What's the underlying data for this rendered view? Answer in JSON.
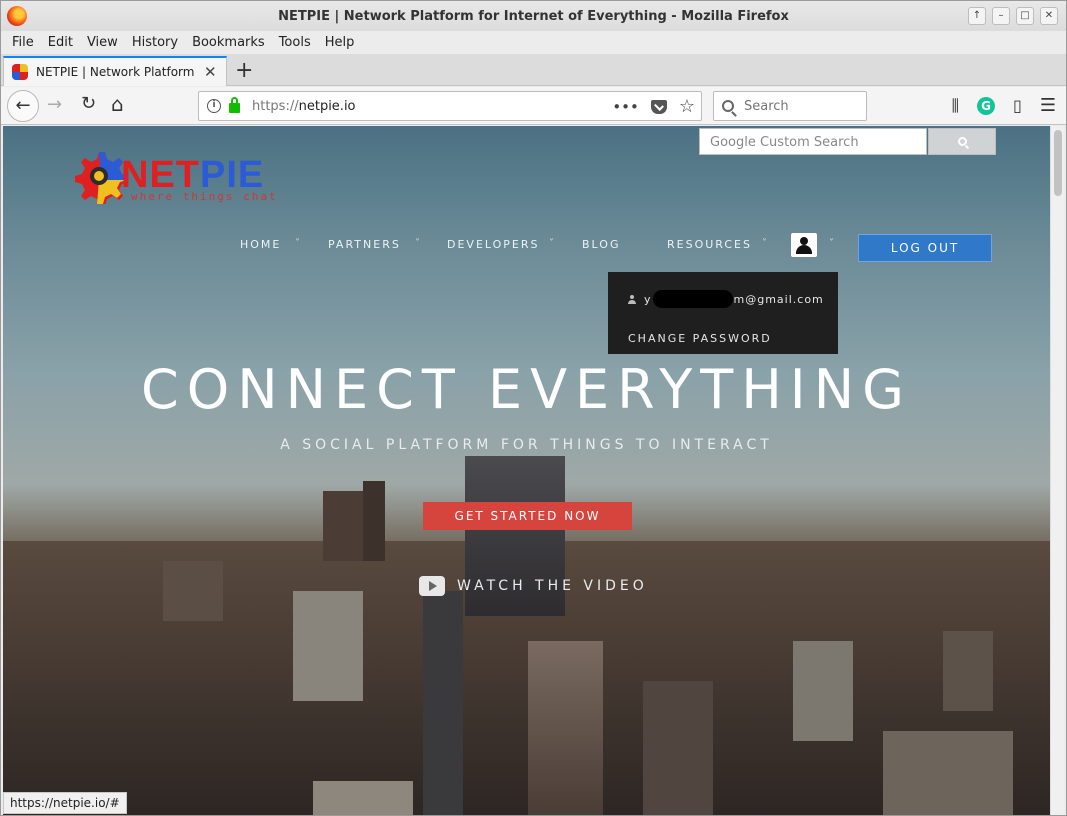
{
  "window": {
    "title": "NETPIE | Network Platform for Internet of Everything - Mozilla Firefox",
    "controls": [
      "↑",
      "–",
      "□",
      "✕"
    ]
  },
  "menubar": {
    "items": [
      "File",
      "Edit",
      "View",
      "History",
      "Bookmarks",
      "Tools",
      "Help"
    ]
  },
  "tabs": [
    {
      "label": "NETPIE | Network Platform fo",
      "close": "✕"
    }
  ],
  "newtab_label": "+",
  "toolbar": {
    "back": "←",
    "forward": "→",
    "reload": "↻",
    "home": "⌂",
    "url_scheme": "https://",
    "url_host": "netpie.io",
    "page_actions": "•••",
    "bookmark_star": "☆",
    "search_placeholder": "Search",
    "library": "⫼",
    "reader": "▯",
    "menu": "☰",
    "grammarly": "G"
  },
  "page": {
    "google_search_placeholder": "Google Custom Search",
    "logo": {
      "net": "NET",
      "pie": "PIE",
      "tagline": "where things chat"
    },
    "nav": [
      {
        "label": "HOME",
        "chevron": "˅"
      },
      {
        "label": "PARTNERS",
        "chevron": "˅"
      },
      {
        "label": "DEVELOPERS",
        "chevron": "˅"
      },
      {
        "label": "BLOG"
      },
      {
        "label": "RESOURCES",
        "chevron": "˅"
      }
    ],
    "user_chevron": "˅",
    "logout": "LOG OUT",
    "dropdown": {
      "email_prefix": "y",
      "email_suffix": "m@gmail.com",
      "change_password": "CHANGE PASSWORD"
    },
    "hero_title": "CONNECT EVERYTHING",
    "hero_subtitle": "A SOCIAL PLATFORM FOR THINGS TO INTERACT",
    "cta": "GET STARTED NOW",
    "watch": "WATCH THE VIDEO"
  },
  "status_url": "https://netpie.io/#"
}
